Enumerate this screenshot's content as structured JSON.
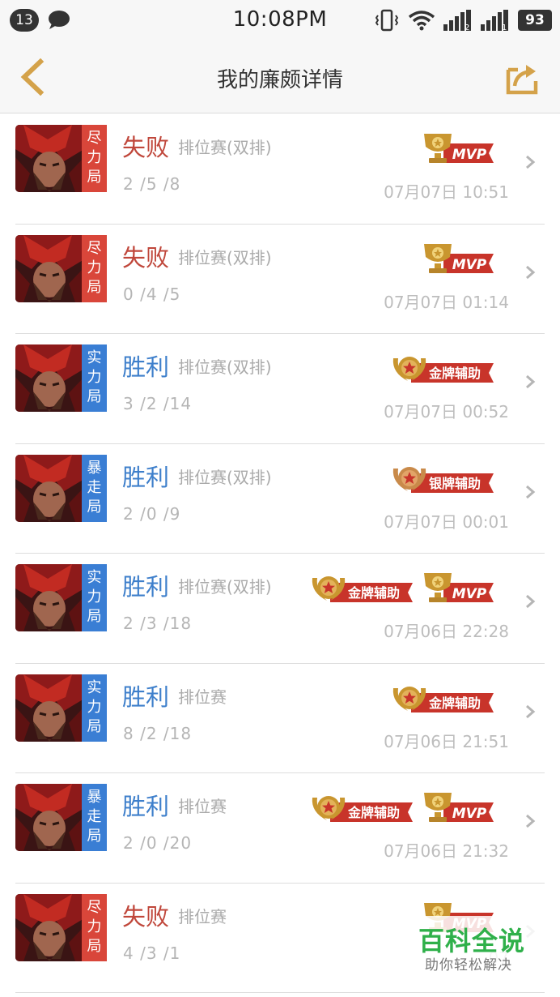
{
  "status_bar": {
    "notification_count": "13",
    "time": "10:08PM",
    "battery": "93",
    "sim1": "2",
    "sim2": "1"
  },
  "nav": {
    "title": "我的廉颇详情",
    "back_icon": "back-arrow-icon",
    "share_icon": "share-icon",
    "accent_color": "#d4a24a"
  },
  "matches": [
    {
      "mode": [
        "尽",
        "力",
        "局"
      ],
      "mode_color": "red",
      "result": "失败",
      "outcome": "loss",
      "type": "排位赛(双排)",
      "kda": "2 /5 /8",
      "time": "07月07日 10:51",
      "badges": [
        "mvp"
      ]
    },
    {
      "mode": [
        "尽",
        "力",
        "局"
      ],
      "mode_color": "red",
      "result": "失败",
      "outcome": "loss",
      "type": "排位赛(双排)",
      "kda": "0 /4 /5",
      "time": "07月07日 01:14",
      "badges": [
        "mvp"
      ]
    },
    {
      "mode": [
        "实",
        "力",
        "局"
      ],
      "mode_color": "blue",
      "result": "胜利",
      "outcome": "win",
      "type": "排位赛(双排)",
      "kda": "3 /2 /14",
      "time": "07月07日 00:52",
      "badges": [
        "gold"
      ]
    },
    {
      "mode": [
        "暴",
        "走",
        "局"
      ],
      "mode_color": "blue",
      "result": "胜利",
      "outcome": "win",
      "type": "排位赛(双排)",
      "kda": "2 /0 /9",
      "time": "07月07日 00:01",
      "badges": [
        "silver"
      ]
    },
    {
      "mode": [
        "实",
        "力",
        "局"
      ],
      "mode_color": "blue",
      "result": "胜利",
      "outcome": "win",
      "type": "排位赛(双排)",
      "kda": "2 /3 /18",
      "time": "07月06日 22:28",
      "badges": [
        "gold",
        "mvp"
      ]
    },
    {
      "mode": [
        "实",
        "力",
        "局"
      ],
      "mode_color": "blue",
      "result": "胜利",
      "outcome": "win",
      "type": "排位赛",
      "kda": "8 /2 /18",
      "time": "07月06日 21:51",
      "badges": [
        "gold"
      ]
    },
    {
      "mode": [
        "暴",
        "走",
        "局"
      ],
      "mode_color": "blue",
      "result": "胜利",
      "outcome": "win",
      "type": "排位赛",
      "kda": "2 /0 /20",
      "time": "07月06日 21:32",
      "badges": [
        "gold",
        "mvp"
      ]
    },
    {
      "mode": [
        "尽",
        "力",
        "局"
      ],
      "mode_color": "red",
      "result": "失败",
      "outcome": "loss",
      "type": "排位赛",
      "kda": "4 /3 /1",
      "time": "07",
      "badges": [
        "mvp"
      ]
    }
  ],
  "badge_labels": {
    "mvp": "MVP",
    "gold": "金牌辅助",
    "silver": "银牌辅助"
  },
  "watermark": {
    "title": "百科全说",
    "subtitle": "助你轻松解决"
  }
}
